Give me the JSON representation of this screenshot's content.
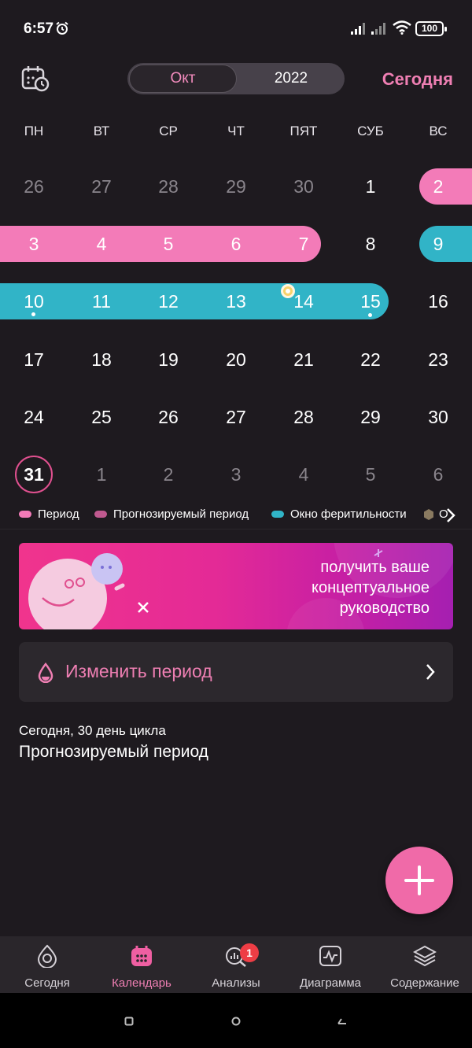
{
  "status_bar": {
    "time": "6:57",
    "battery": "100"
  },
  "header": {
    "month": "Окт",
    "year": "2022",
    "today_button": "Сегодня"
  },
  "weekdays": [
    "ПН",
    "ВТ",
    "СР",
    "ЧТ",
    "ПЯТ",
    "СУБ",
    "ВС"
  ],
  "weeks": [
    [
      "26",
      "27",
      "28",
      "29",
      "30",
      "1",
      "2"
    ],
    [
      "3",
      "4",
      "5",
      "6",
      "7",
      "8",
      "9"
    ],
    [
      "10",
      "11",
      "12",
      "13",
      "14",
      "15",
      "16"
    ],
    [
      "17",
      "18",
      "19",
      "20",
      "21",
      "22",
      "23"
    ],
    [
      "24",
      "25",
      "26",
      "27",
      "28",
      "29",
      "30"
    ],
    [
      "31",
      "1",
      "2",
      "3",
      "4",
      "5",
      "6"
    ]
  ],
  "legend": {
    "period": "Период",
    "predicted": "Прогнозируемый период",
    "fertile": "Окно феритильности",
    "extra": "О"
  },
  "colors": {
    "period": "#f37bb8",
    "predicted": "#c0598f",
    "fertile": "#31b4c7",
    "ovulation": "#8a7a60",
    "accent": "#ef7fb3"
  },
  "banner": {
    "line1": "получить ваше",
    "line2": "концептуальное",
    "line3": "руководство"
  },
  "change_period": {
    "label": "Изменить период"
  },
  "cycle_info": {
    "day_text": "Сегодня, 30 день цикла",
    "phase": "Прогнозируемый период"
  },
  "bottom_nav": {
    "today": "Сегодня",
    "calendar": "Календарь",
    "analysis": "Анализы",
    "analysis_badge": "1",
    "chart": "Диаграмма",
    "content": "Содержание"
  }
}
